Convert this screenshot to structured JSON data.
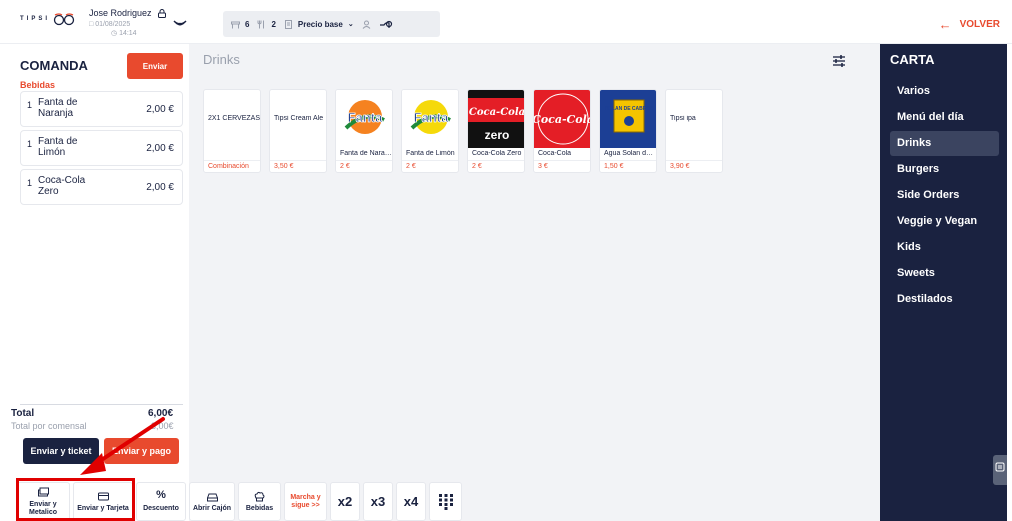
{
  "header": {
    "logo_text": "TIPSI",
    "user_name": "Jose Rodriguez",
    "date": "01/08/2025",
    "time": "14:14",
    "tables": "6",
    "diners": "2",
    "price_mode": "Precio base",
    "back_label": "VOLVER"
  },
  "comanda": {
    "title": "COMANDA",
    "send_label": "Enviar",
    "category": "Bebidas",
    "items": [
      {
        "qty": "1",
        "name": "Fanta de Naranja",
        "price": "2,00 €"
      },
      {
        "qty": "1",
        "name": "Fanta de Limón",
        "price": "2,00 €"
      },
      {
        "qty": "1",
        "name": "Coca-Cola Zero",
        "price": "2,00 €"
      }
    ],
    "total_label": "Total",
    "total_value": "6,00€",
    "per_diner_label": "Total por comensal",
    "per_diner_value": "3,00€",
    "send_ticket_label": "Enviar y ticket",
    "send_pay_label": "Enviar y pago"
  },
  "main": {
    "section_title": "Drinks",
    "products": [
      {
        "name": "2X1 CERVEZAS",
        "price": "Combinación",
        "image": "none"
      },
      {
        "name": "Tipsi Cream Ale",
        "price": "3,50 €",
        "image": "none"
      },
      {
        "name": "Fanta de Naranja",
        "price": "2 €",
        "image": "fanta-orange"
      },
      {
        "name": "Fanta de Limón",
        "price": "2 €",
        "image": "fanta-lemon"
      },
      {
        "name": "Coca-Cola Zero",
        "price": "2 €",
        "image": "coca-cola-zero"
      },
      {
        "name": "Coca-Cola",
        "price": "3 €",
        "image": "coca-cola"
      },
      {
        "name": "Agua Solan de Cabras",
        "price": "1,50 €",
        "image": "solan-de-cabras"
      },
      {
        "name": "Tipsi ipa",
        "price": "3,90 €",
        "image": "none"
      }
    ],
    "logo_texts": {
      "fanta": "Fanta",
      "coca": "Coca-Cola",
      "zero": "zero",
      "solan": "SOLAN DE CABRAS"
    }
  },
  "toolbar": {
    "buttons": [
      {
        "label": "Enviar y Metalico",
        "icon": "cash-icon"
      },
      {
        "label": "Enviar y Tarjeta",
        "icon": "card-icon"
      },
      {
        "label": "Descuento",
        "icon": "percent-icon"
      },
      {
        "label": "Abrir Cajón",
        "icon": "drawer-icon"
      },
      {
        "label": "Bebidas",
        "icon": "chef-hat-icon"
      },
      {
        "label": "Marcha y sigue >>",
        "icon": "none"
      },
      {
        "label": "x2"
      },
      {
        "label": "x3"
      },
      {
        "label": "x4"
      },
      {
        "label": "",
        "icon": "keypad-icon"
      }
    ]
  },
  "carta": {
    "title": "CARTA",
    "items": [
      "Varios",
      "Menú del día",
      "Drinks",
      "Burgers",
      "Side Orders",
      "Veggie y Vegan",
      "Kids",
      "Sweets",
      "Destilados"
    ],
    "active": "Drinks"
  },
  "colors": {
    "navy": "#1a2240",
    "accent": "#e84a2e",
    "highlight": "#e00000"
  }
}
